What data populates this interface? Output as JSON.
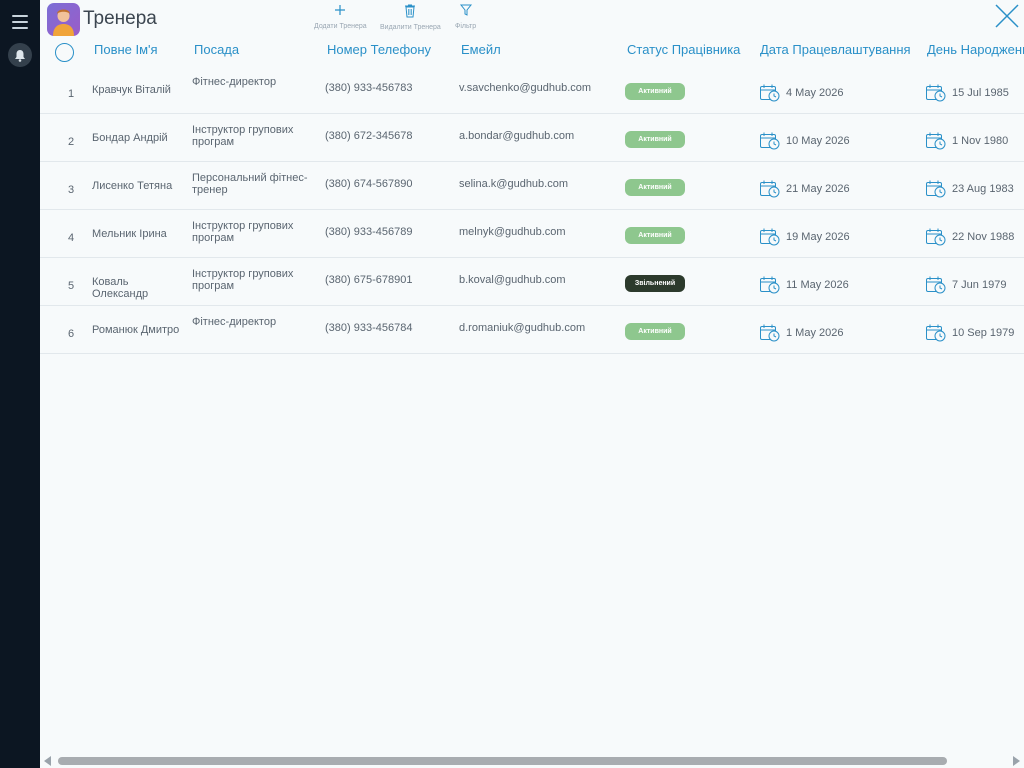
{
  "header": {
    "title": "Тренера",
    "toolbar": {
      "add_label": "Додати Тренера",
      "delete_label": "Видалити Тренера",
      "filter_label": "Фільтр"
    }
  },
  "colors": {
    "accent": "#2a90c8",
    "sidebar": "#0c1622",
    "active_badge": "#8ec78e",
    "fired_badge": "#2c3a2c"
  },
  "table": {
    "columns": [
      "Повне Ім'я",
      "Посада",
      "Номер Телефону",
      "Емейл",
      "Статус Працівника",
      "Дата Працевлаштування",
      "День Народження"
    ],
    "rows": [
      {
        "num": "1",
        "name": "Кравчук Віталій",
        "position": "Фітнес-директор",
        "phone": "(380) 933-456783",
        "email": "v.savchenko@gudhub.com",
        "status": "Активний",
        "hire_date": "4 May 2026",
        "birthday": "15 Jul 1985"
      },
      {
        "num": "2",
        "name": "Бондар Андрій",
        "position": "Інструктор групових програм",
        "phone": "(380) 672-345678",
        "email": "a.bondar@gudhub.com",
        "status": "Активний",
        "hire_date": "10 May 2026",
        "birthday": "1 Nov 1980"
      },
      {
        "num": "3",
        "name": "Лисенко Тетяна",
        "position": "Персональний фітнес-тренер",
        "phone": "(380) 674-567890",
        "email": "selina.k@gudhub.com",
        "status": "Активний",
        "hire_date": "21 May 2026",
        "birthday": "23 Aug 1983"
      },
      {
        "num": "4",
        "name": "Мельник Ірина",
        "position": "Інструктор групових програм",
        "phone": "(380) 933-456789",
        "email": "melnyk@gudhub.com",
        "status": "Активний",
        "hire_date": "19 May 2026",
        "birthday": "22 Nov 1988"
      },
      {
        "num": "5",
        "name": "Коваль Олександр",
        "position": "Інструктор групових програм",
        "phone": "(380) 675-678901",
        "email": "b.koval@gudhub.com",
        "status": "Звільнений",
        "hire_date": "11 May 2026",
        "birthday": "7 Jun 1979"
      },
      {
        "num": "6",
        "name": "Романюк Дмитро",
        "position": "Фітнес-директор",
        "phone": "(380) 933-456784",
        "email": "d.romaniuk@gudhub.com",
        "status": "Активний",
        "hire_date": "1 May 2026",
        "birthday": "10 Sep 1979"
      }
    ]
  }
}
